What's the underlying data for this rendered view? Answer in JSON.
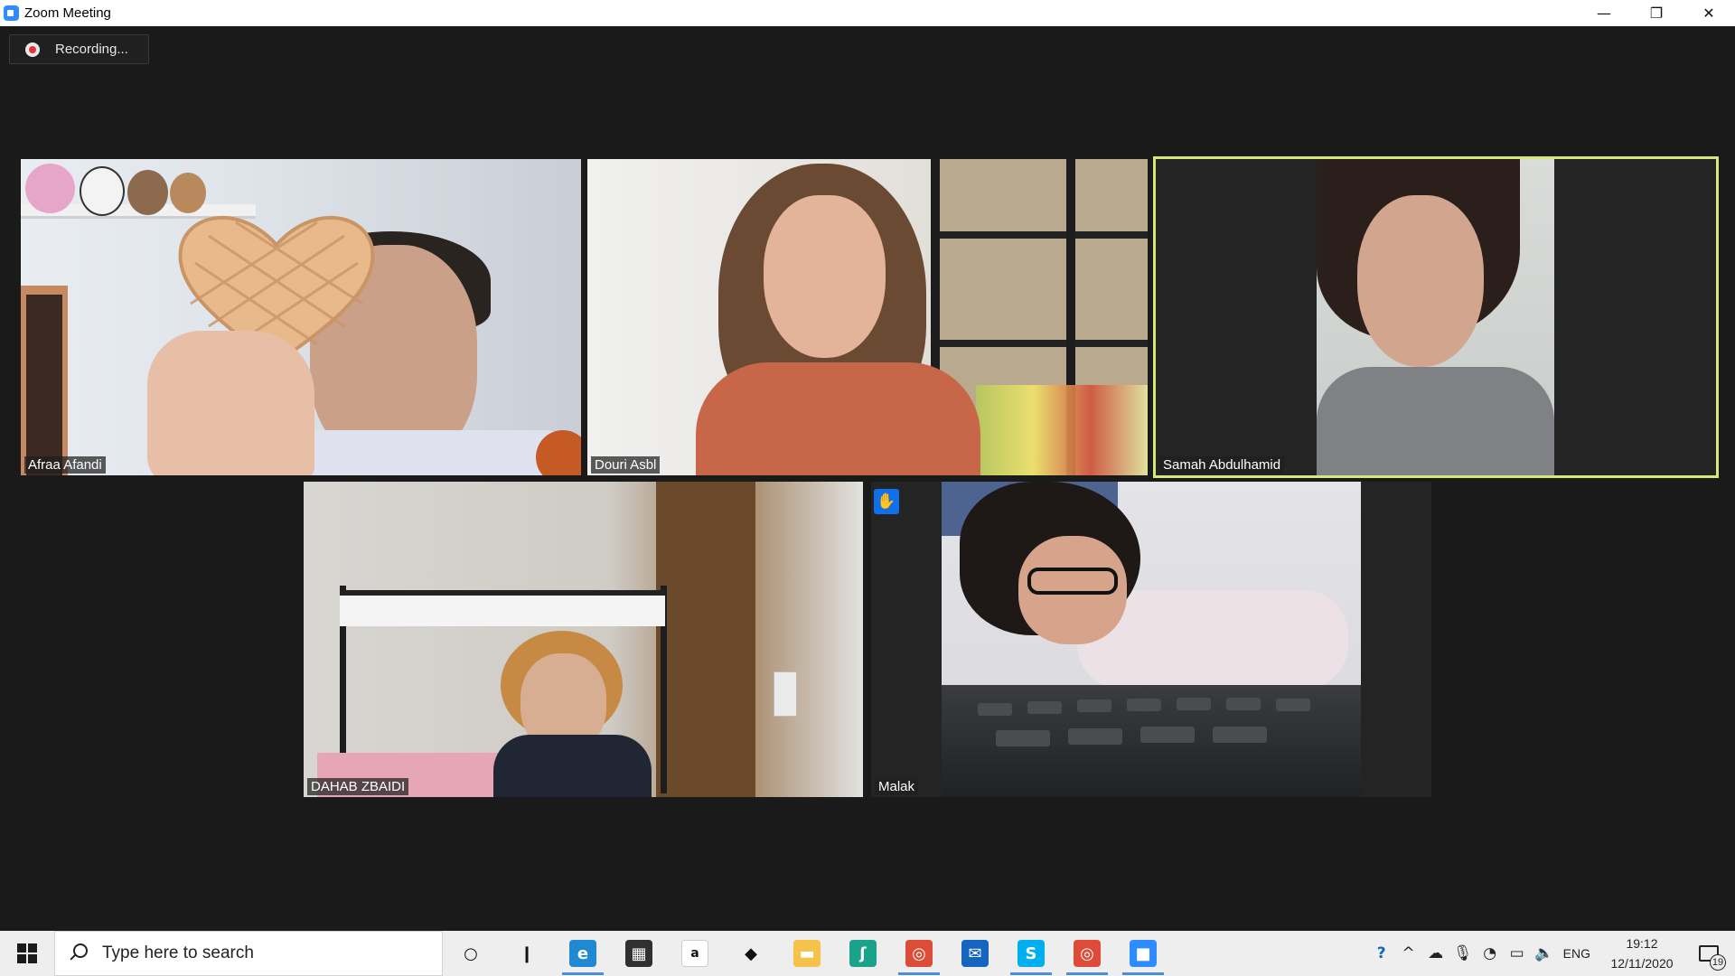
{
  "window": {
    "title": "Zoom Meeting",
    "minimize_glyph": "—",
    "restore_glyph": "❐",
    "close_glyph": "✕"
  },
  "recording": {
    "label": "Recording..."
  },
  "participants": [
    {
      "name": "Afraa Afandi",
      "video": true,
      "active_speaker": false
    },
    {
      "name": "Douri Asbl",
      "video": true,
      "active_speaker": true
    },
    {
      "name": "Samah Abdulhamid",
      "video": true,
      "active_speaker": true
    },
    {
      "name": "DAHAB ZBAIDI",
      "video": true,
      "active_speaker": false
    },
    {
      "name": "Malak",
      "video": true,
      "hand_raised": true,
      "hand_glyph": "✋"
    }
  ],
  "taskbar": {
    "search_placeholder": "Type here to search",
    "apps": [
      {
        "name": "cortana-icon",
        "glyph": "○",
        "color": "#eeeeee"
      },
      {
        "name": "task-view-icon",
        "glyph": "❙",
        "color": "#eeeeee"
      },
      {
        "name": "edge-icon",
        "glyph": "e",
        "color": "#1f8ad2"
      },
      {
        "name": "store-icon",
        "glyph": "▦",
        "color": "#303030"
      },
      {
        "name": "amazon-icon",
        "glyph": "a",
        "color": "#ffffff"
      },
      {
        "name": "dropbox-icon",
        "glyph": "◆",
        "color": "#eeeeee"
      },
      {
        "name": "file-explorer-icon",
        "glyph": "▬",
        "color": "#f5c24b"
      },
      {
        "name": "sway-icon",
        "glyph": "ʃ",
        "color": "#1aa38a"
      },
      {
        "name": "chrome-icon",
        "glyph": "◎",
        "color": "#dd4b39"
      },
      {
        "name": "mail-icon",
        "glyph": "✉",
        "color": "#1565c0"
      },
      {
        "name": "skype-icon",
        "glyph": "S",
        "color": "#00aff0"
      },
      {
        "name": "chrome-profile-icon",
        "glyph": "◎",
        "color": "#dd4b39"
      },
      {
        "name": "zoom-icon",
        "glyph": "■",
        "color": "#2d8cff"
      }
    ],
    "tray": {
      "help_glyph": "?",
      "chevron_glyph": "^",
      "cloud_glyph": "☁",
      "mic_glyph": "🎙",
      "wifi_glyph": "◔",
      "battery_glyph": "▭",
      "volume_glyph": "🔈",
      "language": "ENG",
      "time": "19:12",
      "date": "12/11/2020",
      "notification_count": "19"
    }
  }
}
